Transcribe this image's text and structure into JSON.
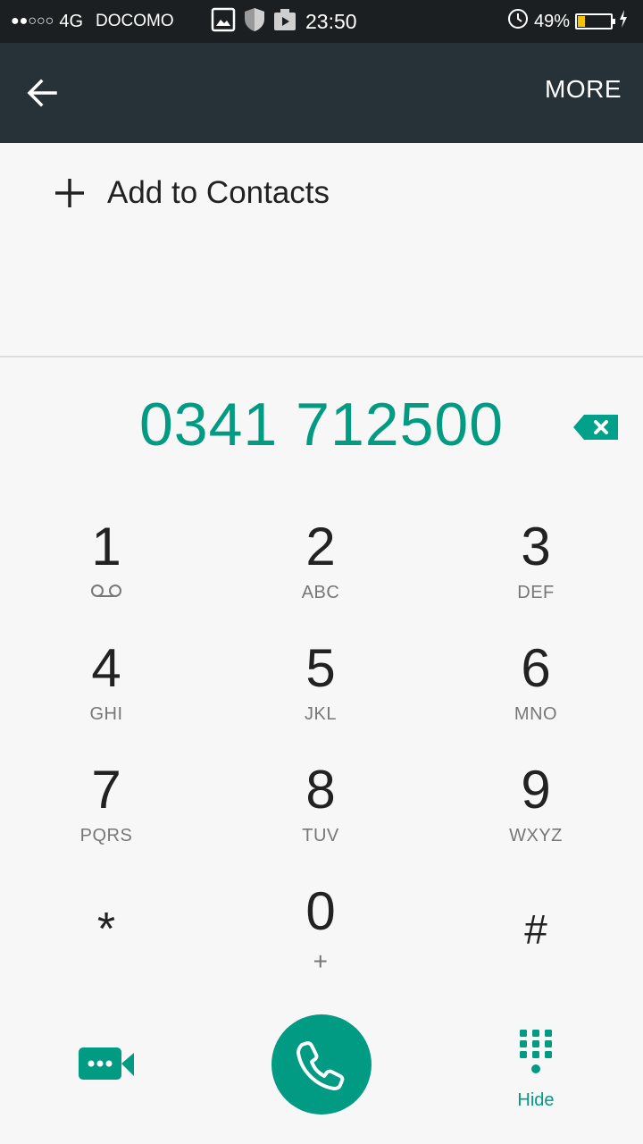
{
  "status_bar": {
    "signal_dots": "●●○○○",
    "network": "4G",
    "carrier": "DOCOMO",
    "time": "23:50",
    "battery_percent": "49%",
    "battery_level": 0.2,
    "icons": [
      "image-icon",
      "shield-icon",
      "media-icon",
      "alarm-icon",
      "charging-icon"
    ]
  },
  "toolbar": {
    "back_icon": "arrow-back-icon",
    "more_label": "MORE"
  },
  "add_contact": {
    "icon": "plus-icon",
    "label": "Add to Contacts"
  },
  "dialer": {
    "number": "0341 712500",
    "backspace_icon": "backspace-icon"
  },
  "keypad": [
    {
      "digit": "1",
      "letters": ""
    },
    {
      "digit": "2",
      "letters": "ABC"
    },
    {
      "digit": "3",
      "letters": "DEF"
    },
    {
      "digit": "4",
      "letters": "GHI"
    },
    {
      "digit": "5",
      "letters": "JKL"
    },
    {
      "digit": "6",
      "letters": "MNO"
    },
    {
      "digit": "7",
      "letters": "PQRS"
    },
    {
      "digit": "8",
      "letters": "TUV"
    },
    {
      "digit": "9",
      "letters": "WXYZ"
    },
    {
      "digit": "*",
      "letters": ""
    },
    {
      "digit": "0",
      "letters": "+"
    },
    {
      "digit": "#",
      "letters": ""
    }
  ],
  "bottom": {
    "video_icon": "video-call-icon",
    "call_icon": "phone-icon",
    "hide_icon": "dialpad-icon",
    "hide_label": "Hide"
  },
  "colors": {
    "accent": "#009b82",
    "toolbar": "#263238",
    "statusbar": "#1b1f21",
    "background": "#f7f7f7"
  }
}
